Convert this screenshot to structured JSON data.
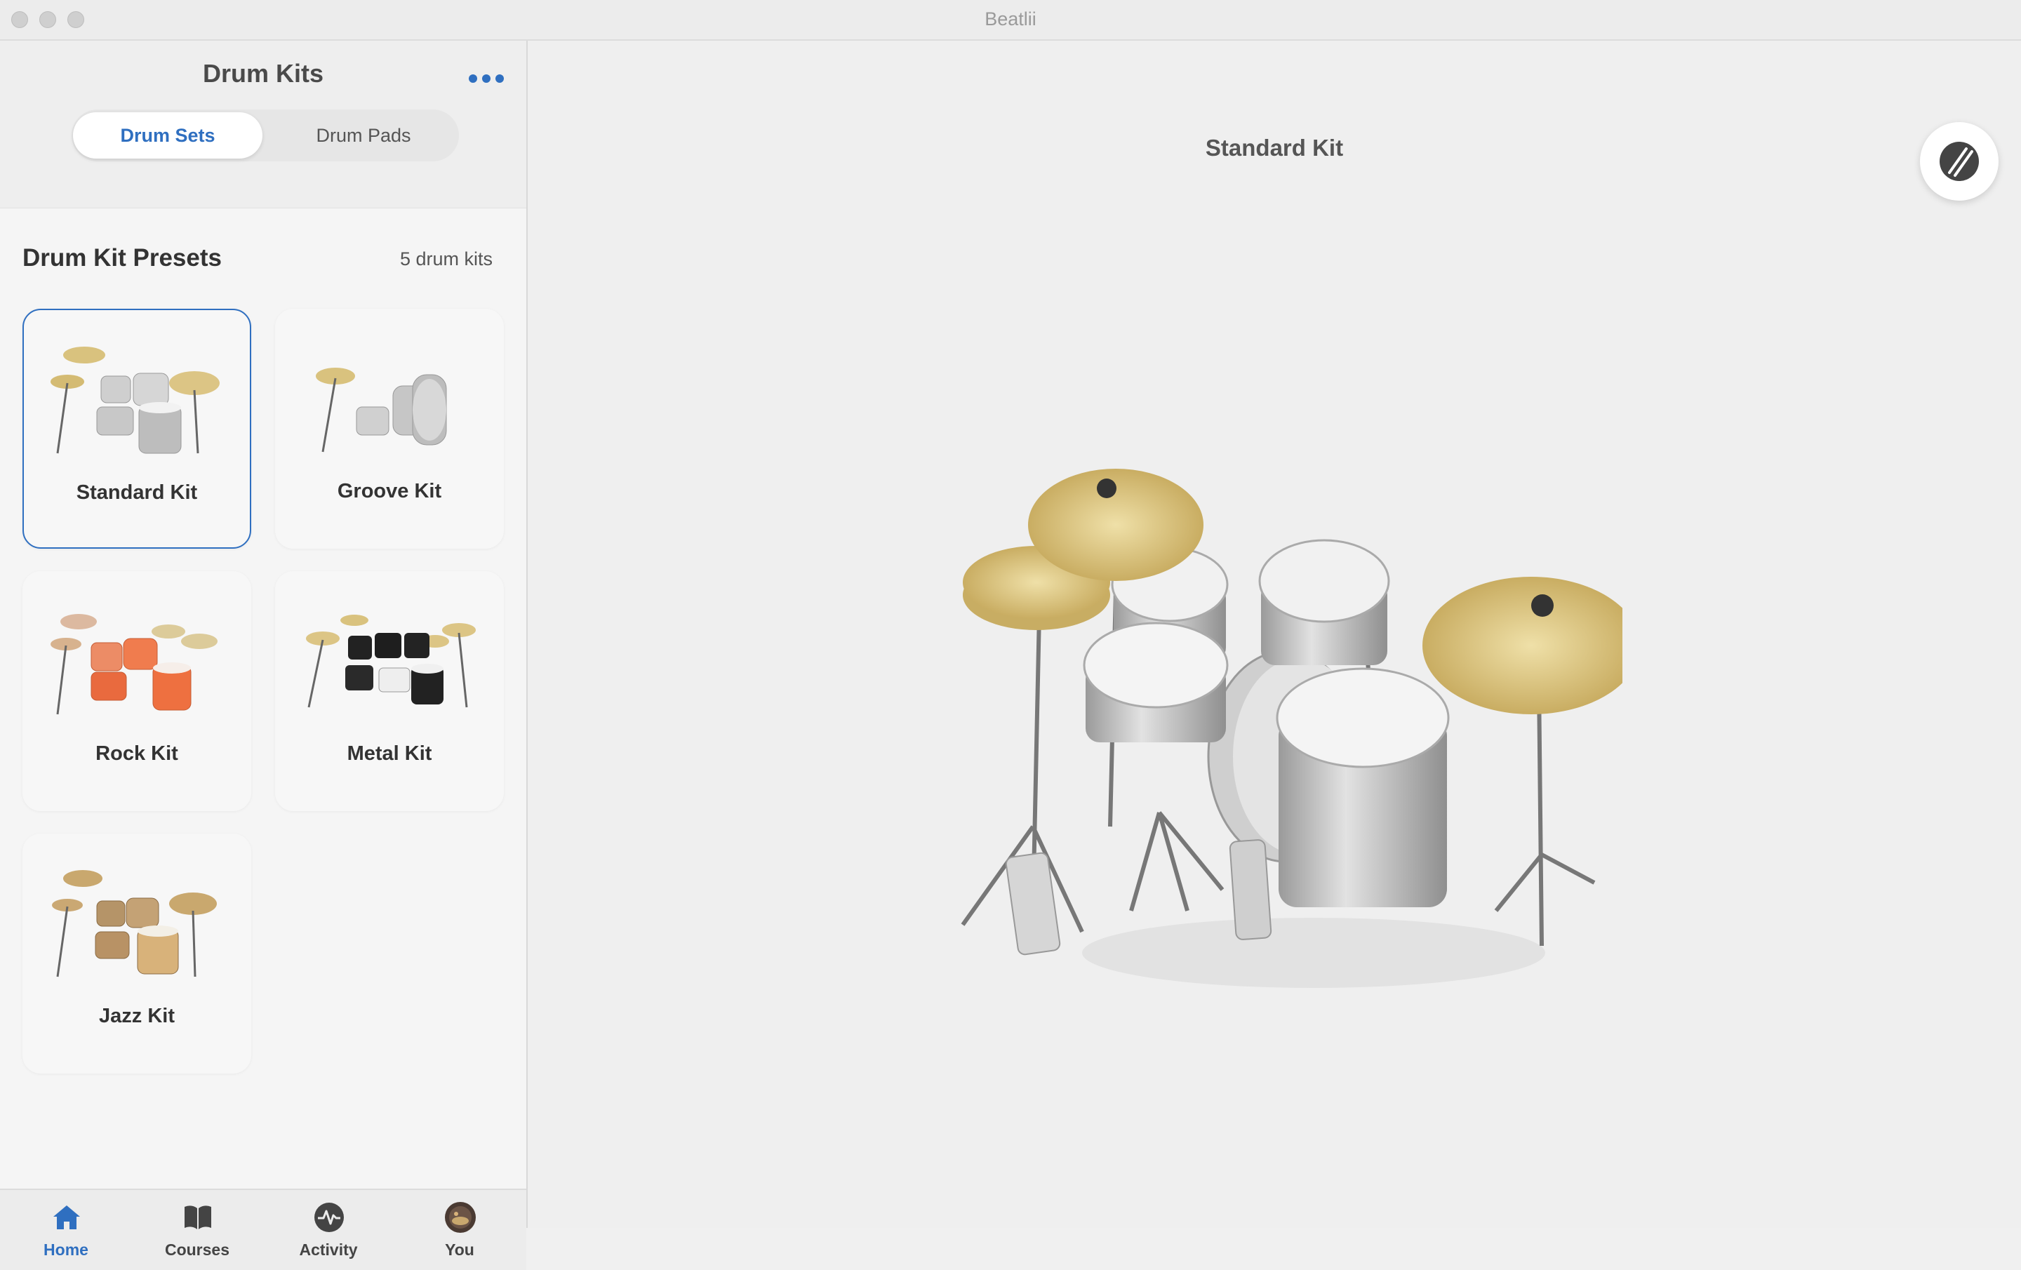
{
  "window": {
    "title": "Beatlii"
  },
  "sidebar": {
    "title": "Drum Kits",
    "more_icon": "ellipsis-icon",
    "segments": [
      {
        "label": "Drum Sets",
        "active": true
      },
      {
        "label": "Drum Pads",
        "active": false
      }
    ],
    "presets_title": "Drum Kit Presets",
    "presets_count": "5 drum kits",
    "kits": [
      {
        "label": "Standard Kit",
        "selected": true,
        "color": "#c9c9c9"
      },
      {
        "label": "Groove Kit",
        "selected": false,
        "color": "#c9c9c9"
      },
      {
        "label": "Rock Kit",
        "selected": false,
        "color": "#e8663a"
      },
      {
        "label": "Metal Kit",
        "selected": false,
        "color": "#222222"
      },
      {
        "label": "Jazz Kit",
        "selected": false,
        "color": "#d8b27a"
      }
    ]
  },
  "tabbar": {
    "tabs": [
      {
        "label": "Home",
        "icon": "home-icon",
        "active": true
      },
      {
        "label": "Courses",
        "icon": "book-icon",
        "active": false
      },
      {
        "label": "Activity",
        "icon": "activity-icon",
        "active": false
      },
      {
        "label": "You",
        "icon": "avatar",
        "active": false
      }
    ]
  },
  "main": {
    "kit_title": "Standard Kit",
    "drumsticks_icon": "drumsticks-icon"
  },
  "colors": {
    "accent": "#2f6fc0",
    "cymbal": "#d9c27e",
    "drum_shell": "#bfbfbf"
  }
}
